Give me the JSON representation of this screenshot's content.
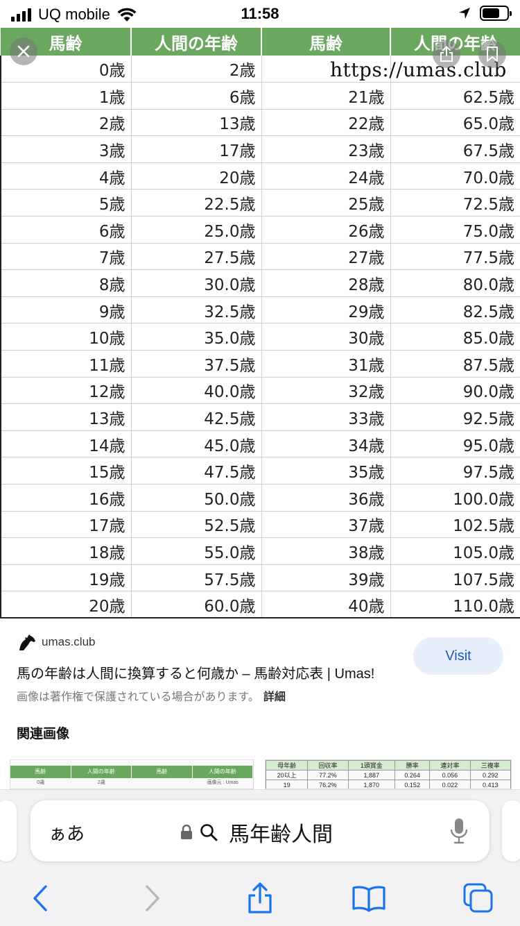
{
  "status_bar": {
    "carrier": "UQ mobile",
    "time": "11:58",
    "icons": [
      "signal-icon",
      "wifi-icon",
      "location-arrow-icon",
      "battery-icon"
    ]
  },
  "viewer": {
    "watermark": "https://umas.club",
    "table": {
      "headers": [
        "馬齢",
        "人間の年齢",
        "馬齢",
        "人間の年齢"
      ],
      "rows": [
        [
          "0歳",
          "2歳",
          "",
          ""
        ],
        [
          "1歳",
          "6歳",
          "21歳",
          "62.5歳"
        ],
        [
          "2歳",
          "13歳",
          "22歳",
          "65.0歳"
        ],
        [
          "3歳",
          "17歳",
          "23歳",
          "67.5歳"
        ],
        [
          "4歳",
          "20歳",
          "24歳",
          "70.0歳"
        ],
        [
          "5歳",
          "22.5歳",
          "25歳",
          "72.5歳"
        ],
        [
          "6歳",
          "25.0歳",
          "26歳",
          "75.0歳"
        ],
        [
          "7歳",
          "27.5歳",
          "27歳",
          "77.5歳"
        ],
        [
          "8歳",
          "30.0歳",
          "28歳",
          "80.0歳"
        ],
        [
          "9歳",
          "32.5歳",
          "29歳",
          "82.5歳"
        ],
        [
          "10歳",
          "35.0歳",
          "30歳",
          "85.0歳"
        ],
        [
          "11歳",
          "37.5歳",
          "31歳",
          "87.5歳"
        ],
        [
          "12歳",
          "40.0歳",
          "32歳",
          "90.0歳"
        ],
        [
          "13歳",
          "42.5歳",
          "33歳",
          "92.5歳"
        ],
        [
          "14歳",
          "45.0歳",
          "34歳",
          "95.0歳"
        ],
        [
          "15歳",
          "47.5歳",
          "35歳",
          "97.5歳"
        ],
        [
          "16歳",
          "50.0歳",
          "36歳",
          "100.0歳"
        ],
        [
          "17歳",
          "52.5歳",
          "37歳",
          "102.5歳"
        ],
        [
          "18歳",
          "55.0歳",
          "38歳",
          "105.0歳"
        ],
        [
          "19歳",
          "57.5歳",
          "39歳",
          "107.5歳"
        ],
        [
          "20歳",
          "60.0歳",
          "40歳",
          "110.0歳"
        ]
      ]
    },
    "header_color": "#6aa75f"
  },
  "info": {
    "source": "umas.club",
    "visit_label": "Visit",
    "title": "馬の年齢は人間に換算すると何歳か – 馬齢対応表 | Umas!",
    "copyright": "画像は著作権で保護されている場合があります。",
    "detail_link": "詳細",
    "related_heading": "関連画像"
  },
  "related": {
    "thumb1_headers": [
      "馬齢",
      "人間の年齢",
      "馬齢",
      "人間の年齢"
    ],
    "thumb1_row": [
      "0歳",
      "2歳",
      "",
      "画像元 : Umas"
    ],
    "thumb2_rows": [
      [
        "母年齢",
        "回収率",
        "1頭賞金",
        "勝率",
        "連対率",
        "三複率"
      ],
      [
        "20以上",
        "77.2%",
        "1,887",
        "0.264",
        "0.056",
        "0.292"
      ],
      [
        "19",
        "76.2%",
        "1,870",
        "0.152",
        "0.022",
        "0.413"
      ]
    ]
  },
  "browser": {
    "aa_label": "ぁあ",
    "query": "馬年齢人間",
    "accent": "#1a73e8"
  }
}
